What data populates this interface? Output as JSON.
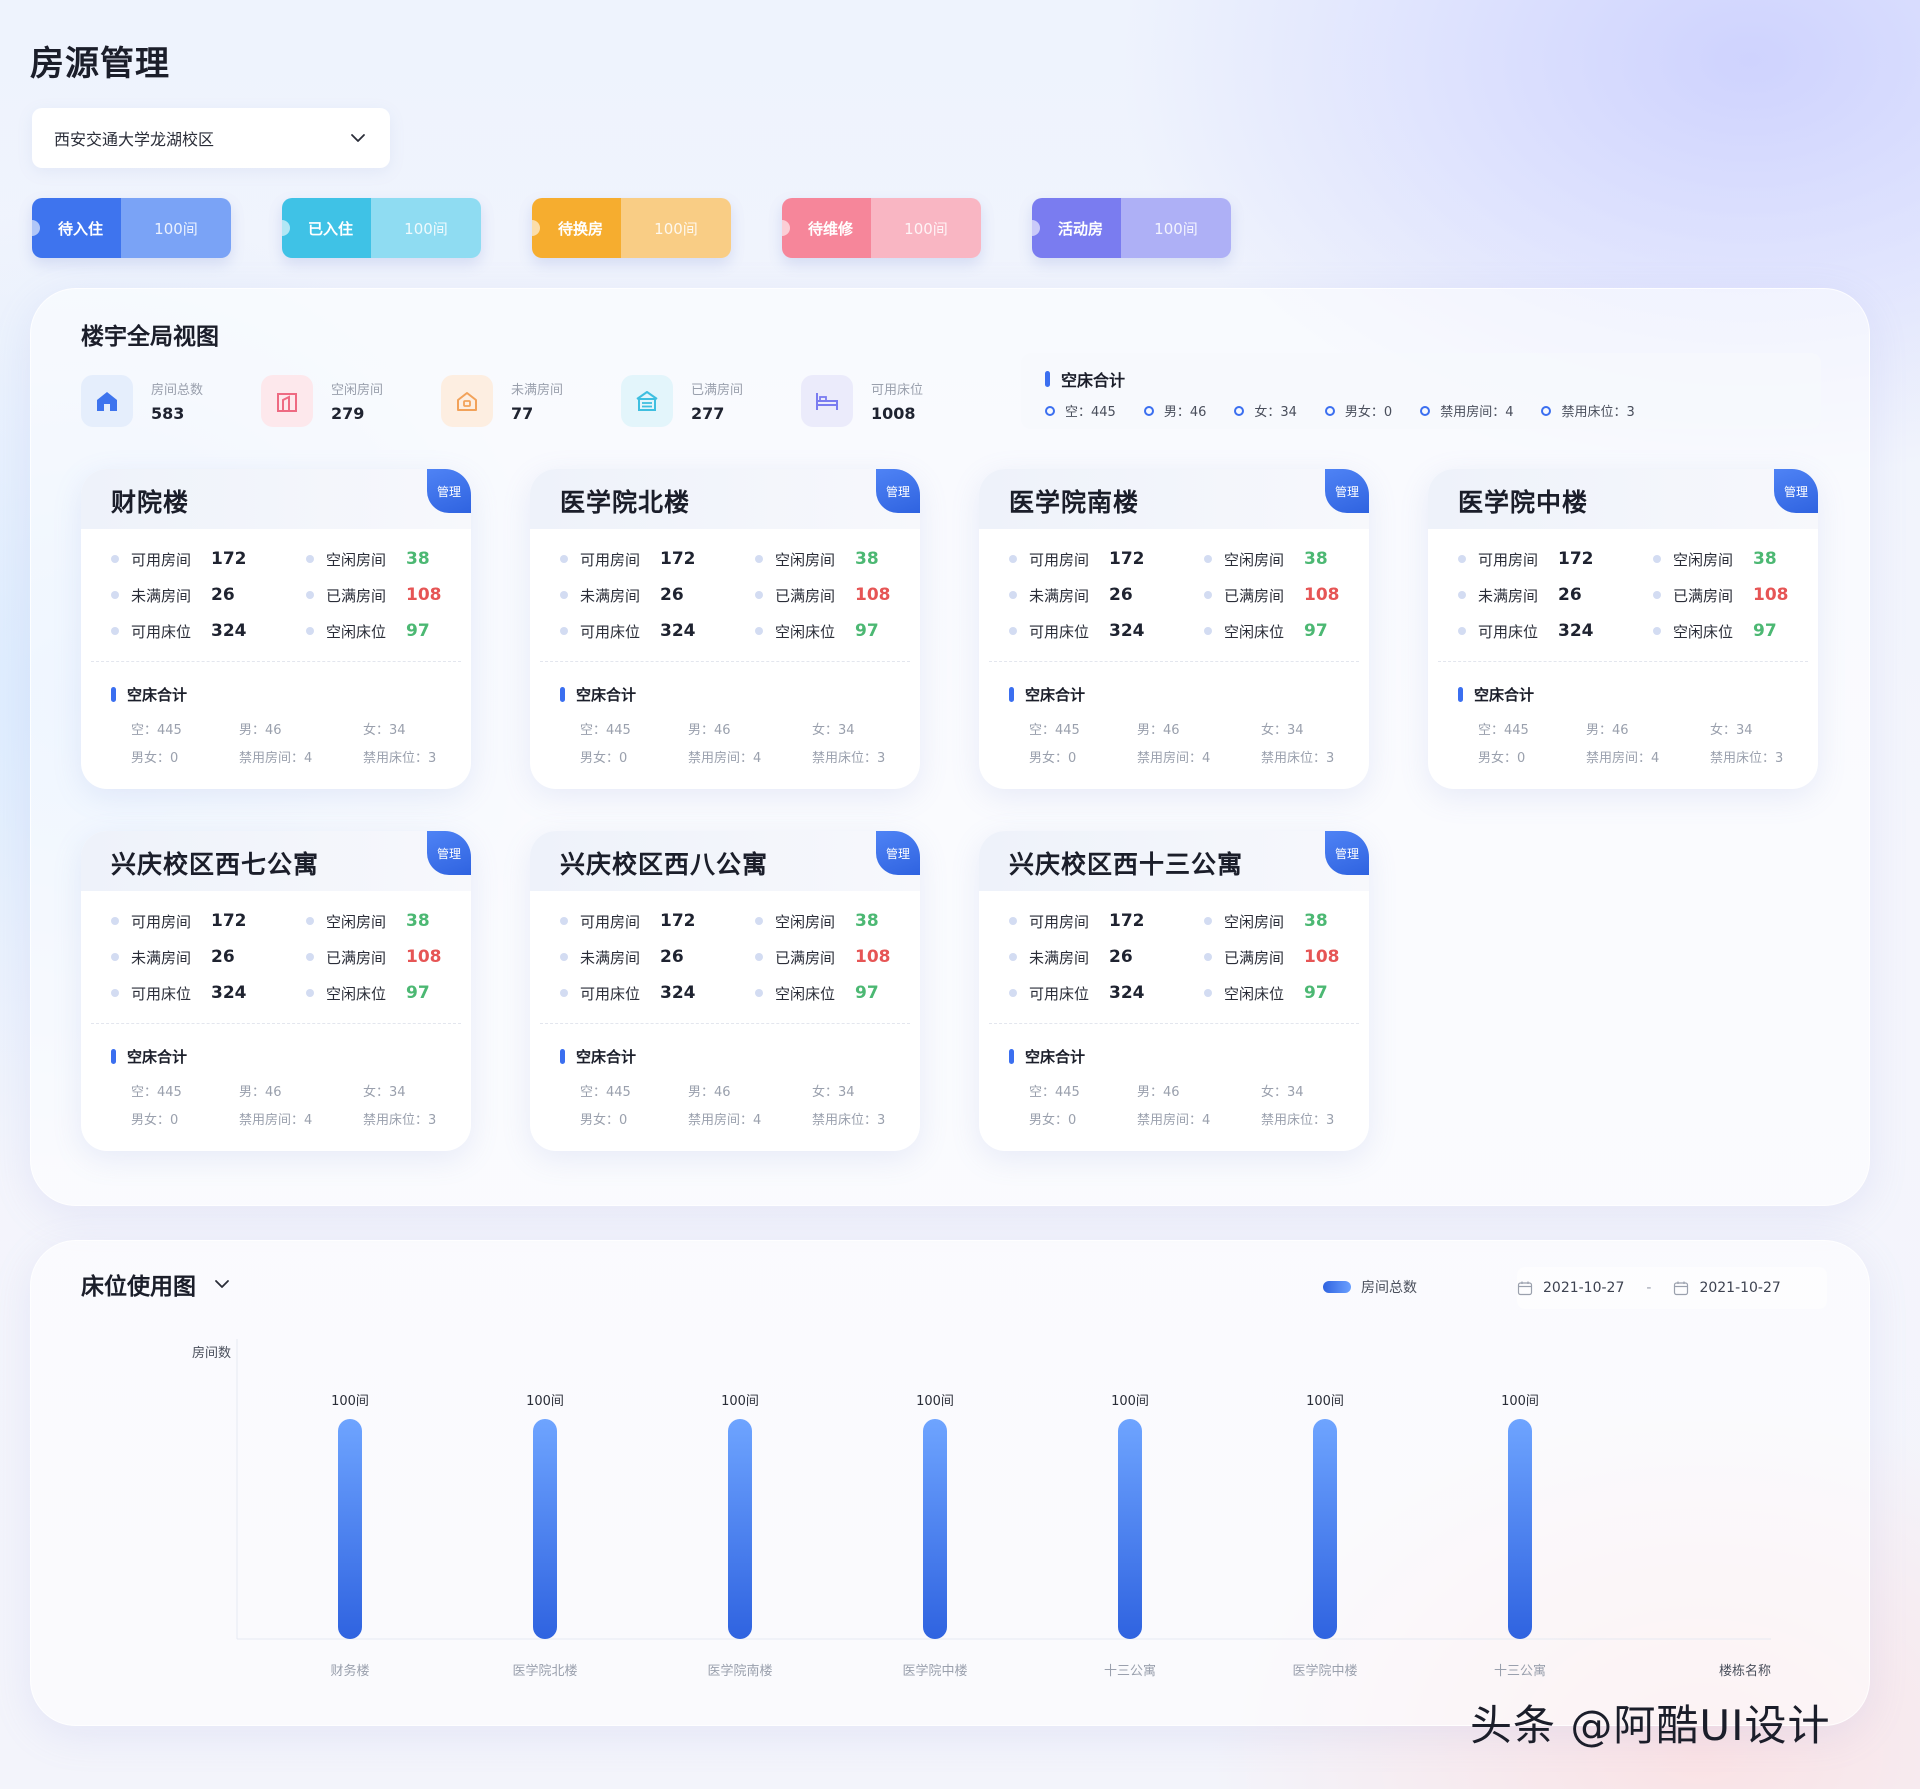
{
  "page_title": "房源管理",
  "campus_select": {
    "value": "西安交通大学龙湖校区"
  },
  "status_pills": [
    {
      "label": "待入住",
      "count": "100间",
      "color_label": "#3e74ee",
      "color_count": "#7aa3f6"
    },
    {
      "label": "已入住",
      "count": "100间",
      "color_label": "#3fc2e6",
      "color_count": "#8fdcf2"
    },
    {
      "label": "待换房",
      "count": "100间",
      "color_label": "#f6ad2f",
      "color_count": "#f9cd85"
    },
    {
      "label": "待维修",
      "count": "100间",
      "color_label": "#f6869a",
      "color_count": "#f9b6c3"
    },
    {
      "label": "活动房",
      "count": "100间",
      "color_label": "#7a7cf0",
      "color_count": "#aeb0f6"
    }
  ],
  "overview": {
    "title": "楼宇全局视图",
    "summary": [
      {
        "icon": "home-icon",
        "label": "房间总数",
        "value": "583",
        "bg": "#e5eefc",
        "fg": "#3e74ee"
      },
      {
        "icon": "building-icon",
        "label": "空闲房间",
        "value": "279",
        "bg": "#fde8ec",
        "fg": "#ee6a82"
      },
      {
        "icon": "house-door-icon",
        "label": "未满房间",
        "value": "77",
        "bg": "#fdeee1",
        "fg": "#f2a25a"
      },
      {
        "icon": "house-full-icon",
        "label": "已满房间",
        "value": "277",
        "bg": "#e3f5fb",
        "fg": "#3fbfe0"
      },
      {
        "icon": "bed-icon",
        "label": "可用床位",
        "value": "1008",
        "bg": "#ebebfb",
        "fg": "#7a7cf0"
      }
    ],
    "vacant_total": {
      "title": "空床合计",
      "items": [
        "空：445",
        "男：46",
        "女：34",
        "男女：0",
        "禁用房间：4",
        "禁用床位：3"
      ]
    },
    "buildings": [
      {
        "name": "财院楼",
        "tag": "管理",
        "available_rooms_label": "可用房间",
        "available_rooms": "172",
        "free_rooms_label": "空闲房间",
        "free_rooms": "38",
        "partial_rooms_label": "未满房间",
        "partial_rooms": "26",
        "full_rooms_label": "已满房间",
        "full_rooms": "108",
        "available_beds_label": "可用床位",
        "available_beds": "324",
        "free_beds_label": "空闲床位",
        "free_beds": "97",
        "vacant_title": "空床合计",
        "vacant": [
          "空：445",
          "男：46",
          "女：34",
          "男女：0",
          "禁用房间：4",
          "禁用床位：3"
        ]
      },
      {
        "name": "医学院北楼",
        "tag": "管理",
        "available_rooms_label": "可用房间",
        "available_rooms": "172",
        "free_rooms_label": "空闲房间",
        "free_rooms": "38",
        "partial_rooms_label": "未满房间",
        "partial_rooms": "26",
        "full_rooms_label": "已满房间",
        "full_rooms": "108",
        "available_beds_label": "可用床位",
        "available_beds": "324",
        "free_beds_label": "空闲床位",
        "free_beds": "97",
        "vacant_title": "空床合计",
        "vacant": [
          "空：445",
          "男：46",
          "女：34",
          "男女：0",
          "禁用房间：4",
          "禁用床位：3"
        ]
      },
      {
        "name": "医学院南楼",
        "tag": "管理",
        "available_rooms_label": "可用房间",
        "available_rooms": "172",
        "free_rooms_label": "空闲房间",
        "free_rooms": "38",
        "partial_rooms_label": "未满房间",
        "partial_rooms": "26",
        "full_rooms_label": "已满房间",
        "full_rooms": "108",
        "available_beds_label": "可用床位",
        "available_beds": "324",
        "free_beds_label": "空闲床位",
        "free_beds": "97",
        "vacant_title": "空床合计",
        "vacant": [
          "空：445",
          "男：46",
          "女：34",
          "男女：0",
          "禁用房间：4",
          "禁用床位：3"
        ]
      },
      {
        "name": "医学院中楼",
        "tag": "管理",
        "available_rooms_label": "可用房间",
        "available_rooms": "172",
        "free_rooms_label": "空闲房间",
        "free_rooms": "38",
        "partial_rooms_label": "未满房间",
        "partial_rooms": "26",
        "full_rooms_label": "已满房间",
        "full_rooms": "108",
        "available_beds_label": "可用床位",
        "available_beds": "324",
        "free_beds_label": "空闲床位",
        "free_beds": "97",
        "vacant_title": "空床合计",
        "vacant": [
          "空：445",
          "男：46",
          "女：34",
          "男女：0",
          "禁用房间：4",
          "禁用床位：3"
        ]
      },
      {
        "name": "兴庆校区西七公寓",
        "tag": "管理",
        "available_rooms_label": "可用房间",
        "available_rooms": "172",
        "free_rooms_label": "空闲房间",
        "free_rooms": "38",
        "partial_rooms_label": "未满房间",
        "partial_rooms": "26",
        "full_rooms_label": "已满房间",
        "full_rooms": "108",
        "available_beds_label": "可用床位",
        "available_beds": "324",
        "free_beds_label": "空闲床位",
        "free_beds": "97",
        "vacant_title": "空床合计",
        "vacant": [
          "空：445",
          "男：46",
          "女：34",
          "男女：0",
          "禁用房间：4",
          "禁用床位：3"
        ]
      },
      {
        "name": "兴庆校区西八公寓",
        "tag": "管理",
        "available_rooms_label": "可用房间",
        "available_rooms": "172",
        "free_rooms_label": "空闲房间",
        "free_rooms": "38",
        "partial_rooms_label": "未满房间",
        "partial_rooms": "26",
        "full_rooms_label": "已满房间",
        "full_rooms": "108",
        "available_beds_label": "可用床位",
        "available_beds": "324",
        "free_beds_label": "空闲床位",
        "free_beds": "97",
        "vacant_title": "空床合计",
        "vacant": [
          "空：445",
          "男：46",
          "女：34",
          "男女：0",
          "禁用房间：4",
          "禁用床位：3"
        ]
      },
      {
        "name": "兴庆校区西十三公寓",
        "tag": "管理",
        "available_rooms_label": "可用房间",
        "available_rooms": "172",
        "free_rooms_label": "空闲房间",
        "free_rooms": "38",
        "partial_rooms_label": "未满房间",
        "partial_rooms": "26",
        "full_rooms_label": "已满房间",
        "full_rooms": "108",
        "available_beds_label": "可用床位",
        "available_beds": "324",
        "free_beds_label": "空闲床位",
        "free_beds": "97",
        "vacant_title": "空床合计",
        "vacant": [
          "空：445",
          "男：46",
          "女：34",
          "男女：0",
          "禁用房间：4",
          "禁用床位：3"
        ]
      }
    ]
  },
  "bed_usage": {
    "title": "床位使用图",
    "legend": "房间总数",
    "date_start": "2021-10-27",
    "date_sep": "-",
    "date_end": "2021-10-27"
  },
  "chart_data": {
    "type": "bar",
    "ylabel": "房间数",
    "xlabel": "楼栋名称",
    "categories": [
      "财务楼",
      "医学院北楼",
      "医学院南楼",
      "医学院中楼",
      "十三公寓",
      "医学院中楼",
      "十三公寓"
    ],
    "series": [
      {
        "name": "房间总数",
        "values": [
          100,
          100,
          100,
          100,
          100,
          100,
          100
        ]
      }
    ],
    "data_labels": [
      "100间",
      "100间",
      "100间",
      "100间",
      "100间",
      "100间",
      "100间"
    ],
    "grid": false,
    "legend_position": "top-right",
    "bar_color": "#3b6ff0"
  },
  "watermark": "头条 @阿酷UI设计"
}
